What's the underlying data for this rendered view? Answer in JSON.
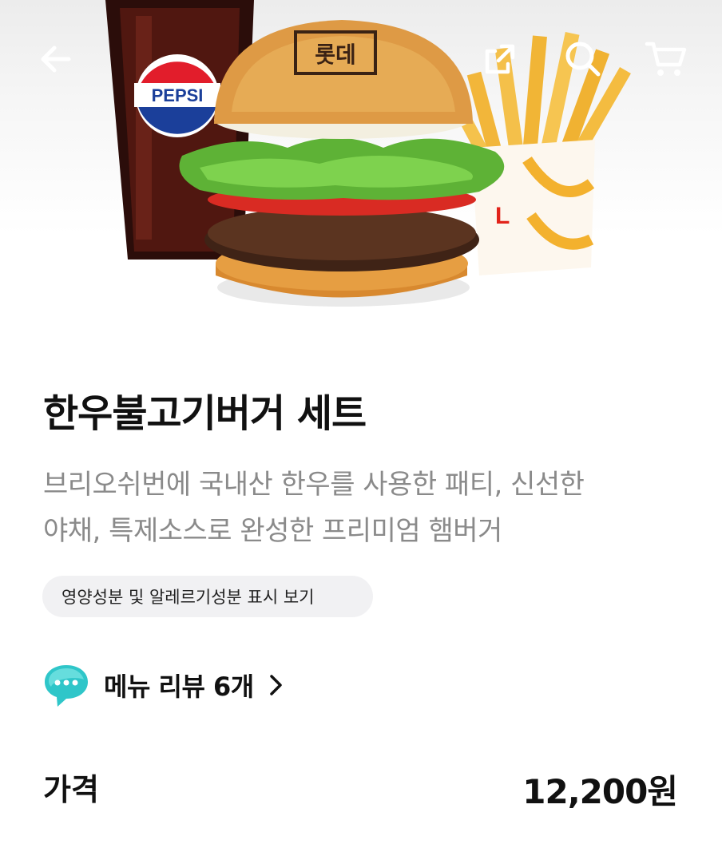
{
  "hero": {
    "cup_brand": "PEPSI",
    "bun_stamp": "롯데",
    "fries_logo": "L"
  },
  "topbar": {
    "icons": [
      "back-arrow-icon",
      "share-icon",
      "search-icon",
      "cart-icon"
    ]
  },
  "product": {
    "name": "한우불고기버거 세트",
    "description_line1": "브리오쉬번에 국내산 한우를 사용한 패티, 신선한",
    "description_line2": "야채, 특제소스로 완성한 프리미엄 햄버거",
    "nutrition_link": "영양성분 및 알레르기성분 표시 보기"
  },
  "review": {
    "label": "메뉴 리뷰 6개"
  },
  "price": {
    "label": "가격",
    "value": "12,200원"
  },
  "colors": {
    "review_bubble": "#2fc6c9",
    "chip_bg": "#f1f1f3",
    "description": "#8a8a8a"
  }
}
